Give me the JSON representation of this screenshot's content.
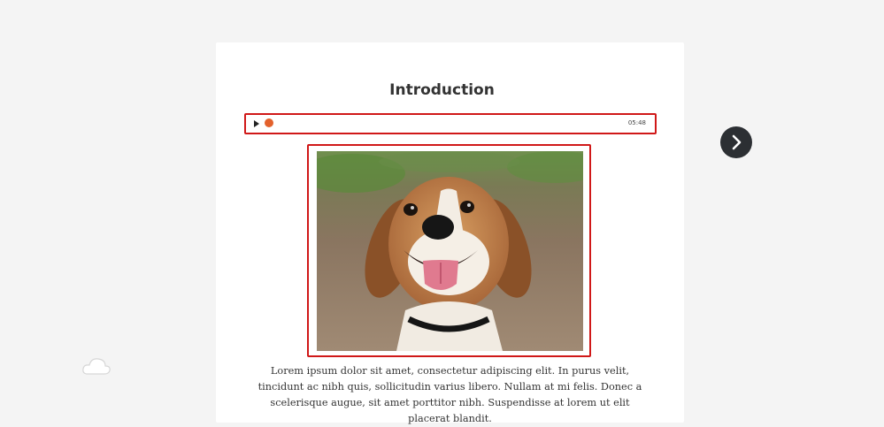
{
  "lesson": {
    "title": "Introduction",
    "body": "Lorem ipsum dolor sit amet, consectetur adipiscing elit. In purus velit, tincidunt ac nibh quis, sollicitudin varius libero. Nullam at mi felis. Donec a scelerisque augue, sit amet porttitor nibh. Suspendisse at lorem ut elit placerat blandit."
  },
  "audio_player": {
    "duration": "05:48",
    "progress": 0,
    "accent_color": "#e3612c"
  },
  "icons": {
    "play": "play-icon",
    "next": "chevron-right-icon",
    "cloud": "cloud-icon"
  },
  "colors": {
    "highlight_border": "#d01818",
    "next_button_bg": "#2c2f33",
    "page_bg": "#f4f4f4"
  }
}
